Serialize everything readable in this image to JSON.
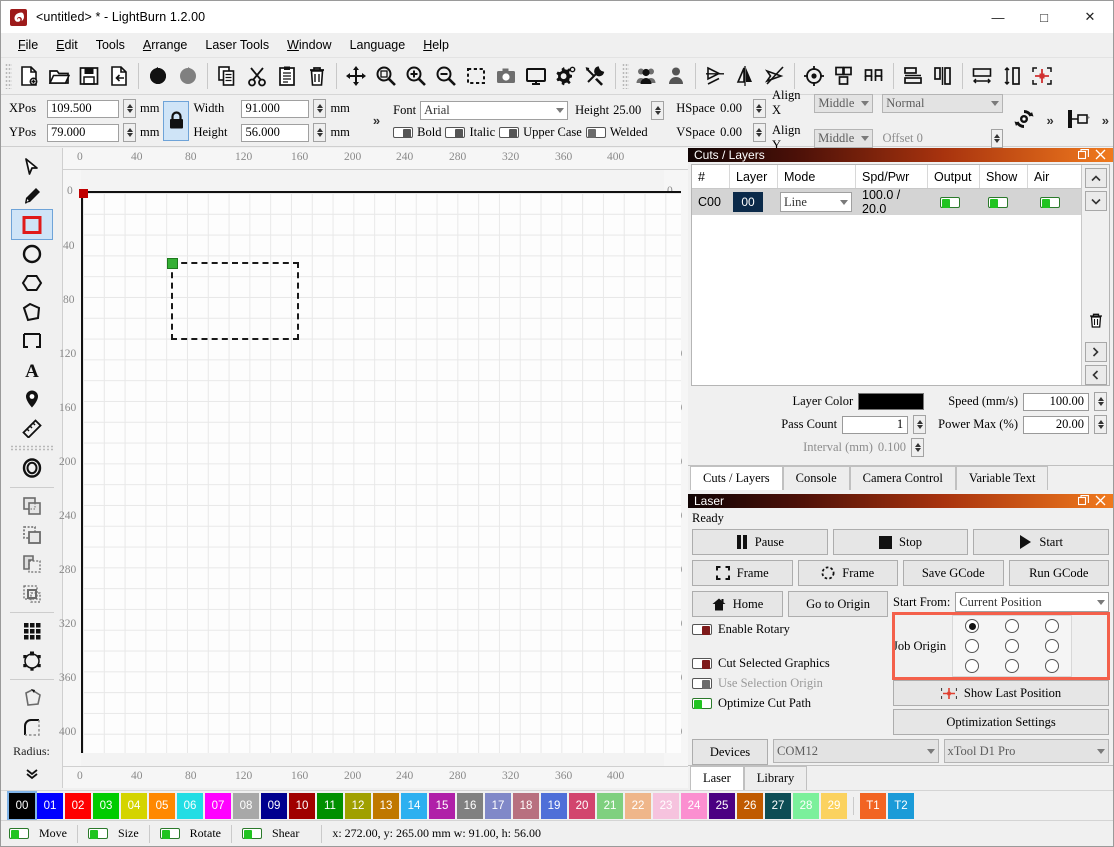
{
  "window": {
    "title": "<untitled> * - LightBurn 1.2.00",
    "minimize": "—",
    "maximize": "□",
    "close": "✕"
  },
  "menubar": {
    "items": [
      {
        "label": "File"
      },
      {
        "label": "Edit"
      },
      {
        "label": "Tools"
      },
      {
        "label": "Arrange"
      },
      {
        "label": "Laser Tools"
      },
      {
        "label": "Window"
      },
      {
        "label": "Language"
      },
      {
        "label": "Help"
      }
    ]
  },
  "toolbar": {
    "icons": [
      "new-file-icon",
      "open-folder-icon",
      "save-icon",
      "export-icon",
      "undo-icon",
      "redo-icon",
      "copy-icon",
      "cut-scissors-icon",
      "paste-icon",
      "delete-trash-icon",
      "move-arrows-icon",
      "zoom-fit-icon",
      "zoom-in-icon",
      "zoom-out-icon",
      "select-frame-icon",
      "camera-icon",
      "monitor-icon",
      "settings-gear-icon",
      "device-tools-icon",
      "group-icon",
      "ungroup-icon",
      "flip-horizontal-icon",
      "flip-vertical-icon",
      "close-path-icon",
      "set-origin-icon",
      "align-nodes-icon",
      "distribute-icon",
      "align-center-h-icon",
      "align-center-v-icon",
      "size-match-icon",
      "space-tool-icon",
      "position-cross-icon"
    ]
  },
  "properties": {
    "xpos_label": "XPos",
    "xpos_value": "109.500",
    "xpos_unit": "mm",
    "ypos_label": "YPos",
    "ypos_value": "79.000",
    "ypos_unit": "mm",
    "width_label": "Width",
    "width_value": "91.000",
    "width_unit": "mm",
    "height_label": "Height",
    "height_value": "56.000",
    "height_unit": "mm",
    "lock_icon": "lock-icon",
    "expand": "»",
    "font_label": "Font",
    "font_value": "Arial",
    "text_height_label": "Height",
    "text_height_value": "25.00",
    "hspace_label": "HSpace",
    "hspace_value": "0.00",
    "vspace_label": "VSpace",
    "vspace_value": "0.00",
    "bold_label": "Bold",
    "italic_label": "Italic",
    "uppercase_label": "Upper Case",
    "welded_label": "Welded",
    "align_x_label": "Align X",
    "align_x_value": "Middle",
    "align_y_label": "Align Y",
    "align_y_value": "Middle",
    "normal_value": "Normal",
    "offset_label": "Offset 0",
    "rotate_icon": "rotate-refresh-icon",
    "mirror_icon": "mirror-across-icon"
  },
  "lefttools": {
    "items": [
      {
        "name": "select-arrow-tool",
        "selected": false
      },
      {
        "name": "pencil-draw-tool",
        "selected": false
      },
      {
        "name": "rectangle-tool",
        "selected": true
      },
      {
        "name": "ellipse-tool",
        "selected": false
      },
      {
        "name": "polygon-tool",
        "selected": false
      },
      {
        "name": "freeform-polygon-tool",
        "selected": false
      },
      {
        "name": "bracket-tool",
        "selected": false
      },
      {
        "name": "text-tool",
        "selected": false
      },
      {
        "name": "node-pin-tool",
        "selected": false
      },
      {
        "name": "measure-ruler-tool",
        "selected": false
      },
      {
        "name": "offset-shapes-tool",
        "selected": false
      },
      {
        "name": "boolean-union-tool",
        "selected": false
      },
      {
        "name": "boolean-subtract-tool",
        "selected": false
      },
      {
        "name": "boolean-intersect-tool",
        "selected": false
      },
      {
        "name": "boolean-exclude-tool",
        "selected": false
      },
      {
        "name": "grid-array-tool",
        "selected": false
      },
      {
        "name": "circular-array-tool",
        "selected": false
      },
      {
        "name": "edit-nodes-tool",
        "selected": false
      },
      {
        "name": "round-corners-tool",
        "selected": false
      }
    ],
    "radius_label": "Radius:",
    "more_icon": "chevron-double-down-icon"
  },
  "canvas": {
    "h_ticks": [
      "0",
      "40",
      "80",
      "120",
      "160",
      "200",
      "240",
      "280",
      "320",
      "360",
      "400"
    ],
    "v_ticks": [
      "0",
      "40",
      "80",
      "120",
      "160",
      "200",
      "240",
      "280",
      "320",
      "360",
      "400"
    ],
    "origin_marker": "origin-red-square",
    "selection_handle": "selection-green-handle"
  },
  "cuts_panel": {
    "title": "Cuts / Layers",
    "restore_icon": "restore-window-icon",
    "close_icon": "close-panel-icon",
    "columns": [
      "#",
      "Layer",
      "Mode",
      "Spd/Pwr",
      "Output",
      "Show",
      "Air"
    ],
    "rows": [
      {
        "num": "C00",
        "layer": "00",
        "mode": "Line",
        "spdpwr": "100.0 / 20.0",
        "output": true,
        "show": true,
        "air": true
      }
    ],
    "move_up_icon": "chevron-up-icon",
    "move_down_icon": "chevron-down-icon",
    "delete_icon": "trash-icon",
    "next_icon": "chevron-right-icon",
    "prev_icon": "chevron-left-icon",
    "settings": {
      "layer_color_label": "Layer Color",
      "layer_color_value": "#000000",
      "pass_count_label": "Pass Count",
      "pass_count_value": "1",
      "interval_label": "Interval (mm)",
      "interval_value": "0.100",
      "speed_label": "Speed (mm/s)",
      "speed_value": "100.00",
      "power_label": "Power Max (%)",
      "power_value": "20.00"
    },
    "tabs": [
      {
        "label": "Cuts / Layers",
        "active": true
      },
      {
        "label": "Console",
        "active": false
      },
      {
        "label": "Camera Control",
        "active": false
      },
      {
        "label": "Variable Text",
        "active": false
      }
    ]
  },
  "laser_panel": {
    "title": "Laser",
    "restore_icon": "restore-window-icon",
    "close_icon": "close-panel-icon",
    "status": "Ready",
    "pause_label": "Pause",
    "stop_label": "Stop",
    "start_label": "Start",
    "frame_square_label": "Frame",
    "frame_round_label": "Frame",
    "save_gcode_label": "Save GCode",
    "run_gcode_label": "Run GCode",
    "home_label": "Home",
    "go_to_origin_label": "Go to Origin",
    "enable_rotary_label": "Enable Rotary",
    "cut_selected_label": "Cut Selected Graphics",
    "use_selection_origin_label": "Use Selection Origin",
    "optimize_cut_path_label": "Optimize Cut Path",
    "start_from_label": "Start From:",
    "start_from_value": "Current Position",
    "job_origin_label": "Job Origin",
    "job_origin_selected_index": 0,
    "show_last_position_label": "Show Last Position",
    "optimization_settings_label": "Optimization Settings",
    "devices_label": "Devices",
    "port_value": "COM12",
    "device_value": "xTool D1 Pro",
    "tabs": [
      {
        "label": "Laser",
        "active": true
      },
      {
        "label": "Library",
        "active": false
      }
    ],
    "highlight_color": "#f4604b"
  },
  "palette": {
    "swatches": [
      {
        "id": "00",
        "color": "#000000",
        "text": "#ffffff",
        "selected": true
      },
      {
        "id": "01",
        "color": "#0000ff",
        "text": "#ffffff"
      },
      {
        "id": "02",
        "color": "#ff0000",
        "text": "#ffffff"
      },
      {
        "id": "03",
        "color": "#00cc00",
        "text": "#ffffff"
      },
      {
        "id": "04",
        "color": "#d4d400",
        "text": "#ffffff"
      },
      {
        "id": "05",
        "color": "#ff8800",
        "text": "#ffffff"
      },
      {
        "id": "06",
        "color": "#22dde4",
        "text": "#ffffff"
      },
      {
        "id": "07",
        "color": "#ff00ff",
        "text": "#ffffff"
      },
      {
        "id": "08",
        "color": "#a8a8a8",
        "text": "#ffffff"
      },
      {
        "id": "09",
        "color": "#00008f",
        "text": "#ffffff"
      },
      {
        "id": "10",
        "color": "#a00000",
        "text": "#ffffff"
      },
      {
        "id": "11",
        "color": "#009000",
        "text": "#ffffff"
      },
      {
        "id": "12",
        "color": "#a0a000",
        "text": "#ffffff"
      },
      {
        "id": "13",
        "color": "#c07800",
        "text": "#ffffff"
      },
      {
        "id": "14",
        "color": "#2db0f0",
        "text": "#ffffff"
      },
      {
        "id": "15",
        "color": "#b020a8",
        "text": "#ffffff"
      },
      {
        "id": "16",
        "color": "#808080",
        "text": "#ffffff"
      },
      {
        "id": "17",
        "color": "#8088c8",
        "text": "#ffffff"
      },
      {
        "id": "18",
        "color": "#b8707f",
        "text": "#ffffff"
      },
      {
        "id": "19",
        "color": "#4f6fd8",
        "text": "#ffffff"
      },
      {
        "id": "20",
        "color": "#d2456e",
        "text": "#ffffff"
      },
      {
        "id": "21",
        "color": "#7fd07f",
        "text": "#ffffff"
      },
      {
        "id": "22",
        "color": "#efb68a",
        "text": "#ffffff"
      },
      {
        "id": "23",
        "color": "#f6c3de",
        "text": "#ffffff"
      },
      {
        "id": "24",
        "color": "#fb8fd0",
        "text": "#ffffff"
      },
      {
        "id": "25",
        "color": "#4b0082",
        "text": "#ffffff"
      },
      {
        "id": "26",
        "color": "#c05a00",
        "text": "#ffffff"
      },
      {
        "id": "27",
        "color": "#0d4d55",
        "text": "#ffffff"
      },
      {
        "id": "28",
        "color": "#7bf09b",
        "text": "#ffffff"
      },
      {
        "id": "29",
        "color": "#fbd25f",
        "text": "#ffffff"
      },
      {
        "id": "T1",
        "color": "#f26422",
        "text": "#ffffff",
        "sep_before": true
      },
      {
        "id": "T2",
        "color": "#1b9bd8",
        "text": "#ffffff"
      }
    ]
  },
  "statusbar": {
    "move_label": "Move",
    "size_label": "Size",
    "rotate_label": "Rotate",
    "shear_label": "Shear",
    "coords": "x: 272.00,  y: 265.00 mm   w: 91.00,   h: 56.00"
  }
}
